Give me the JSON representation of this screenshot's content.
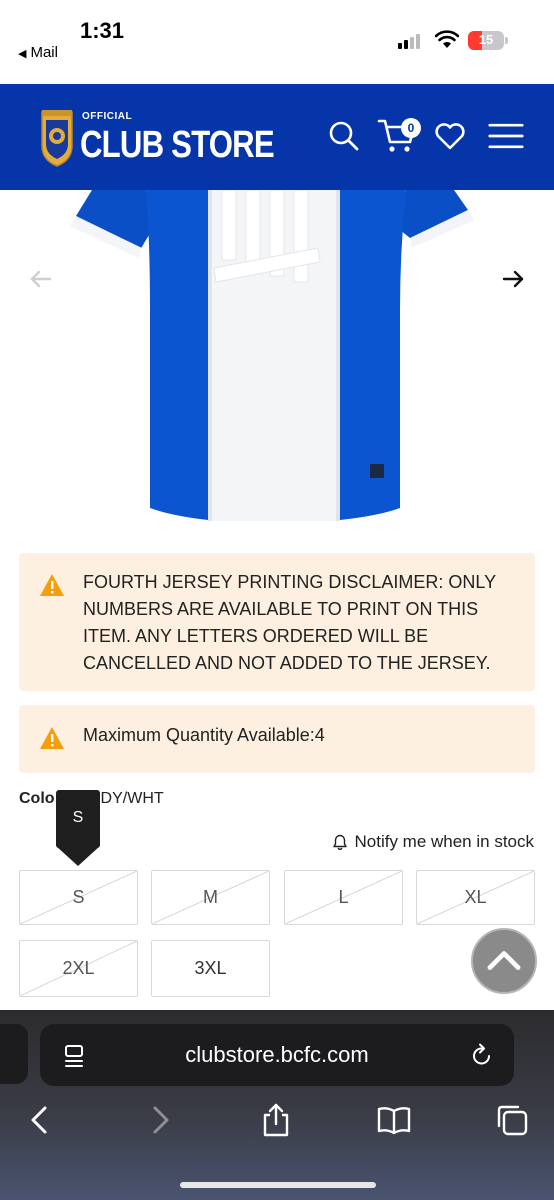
{
  "status_bar": {
    "time": "1:31",
    "back_app": "Mail",
    "battery": "15"
  },
  "header": {
    "logo_small": "OFFICIAL",
    "logo_main": "CLUB STORE",
    "cart_count": "0",
    "brand_color": "#0535a8"
  },
  "notices": [
    {
      "text": "FOURTH JERSEY PRINTING DISCLAIMER: ONLY NUMBERS ARE AVAILABLE TO PRINT ON THIS ITEM. ANY LETTERS ORDERED WILL BE CANCELLED AND NOT ADDED TO THE JERSEY.",
      "icon": "warning-icon"
    },
    {
      "text": "Maximum Quantity Available:4",
      "icon": "warning-icon"
    }
  ],
  "product": {
    "colour_label": "Colo",
    "colour_value": "DY/WHT",
    "tooltip": "S",
    "notify_text": "Notify me when in stock",
    "sizes": [
      {
        "label": "S",
        "out_of_stock": true
      },
      {
        "label": "M",
        "out_of_stock": true
      },
      {
        "label": "L",
        "out_of_stock": true
      },
      {
        "label": "XL",
        "out_of_stock": true
      },
      {
        "label": "2XL",
        "out_of_stock": true
      },
      {
        "label": "3XL",
        "out_of_stock": false
      }
    ]
  },
  "browser": {
    "url": "clubstore.bcfc.com"
  }
}
